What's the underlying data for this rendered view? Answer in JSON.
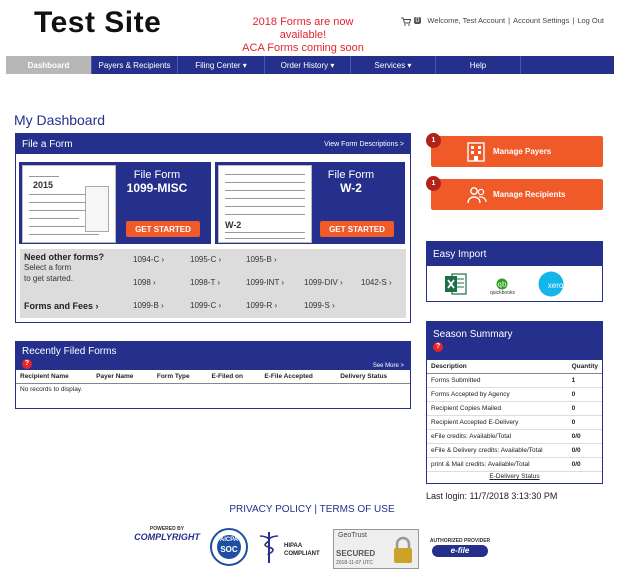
{
  "header": {
    "logo": "Test Site",
    "announce_line1": "2018 Forms are now available!",
    "announce_line2": "ACA Forms coming soon",
    "cart_count": "0",
    "welcome": "Welcome, Test Account",
    "account_settings": "Account Settings",
    "logout": "Log Out"
  },
  "nav": [
    {
      "label": "Dashboard",
      "active": true
    },
    {
      "label": "Payers & Recipients"
    },
    {
      "label": "Filing Center ▾"
    },
    {
      "label": "Order History ▾"
    },
    {
      "label": "Services ▾"
    },
    {
      "label": "Help"
    }
  ],
  "page_title": "My Dashboard",
  "file_form": {
    "title": "File a Form",
    "view_link": "View Form Descriptions >",
    "card1": {
      "label": "File Form",
      "form": "1099-MISC",
      "button": "GET STARTED"
    },
    "card2": {
      "label": "File Form",
      "form": "W-2",
      "button": "GET STARTED"
    },
    "need_other": "Need other forms?",
    "select_line1": "Select a form",
    "select_line2": "to get started.",
    "forms_row1": [
      "1094-C ›",
      "1095-C ›",
      "1095-B ›"
    ],
    "forms_row2": [
      "1098 ›",
      "1098-T ›",
      "1099-INT ›",
      "1099-DIV ›",
      "1042-S ›"
    ],
    "forms_fees": "Forms and Fees ›",
    "forms_row3": [
      "1099-B ›",
      "1099-C ›",
      "1099-R ›",
      "1099-S ›"
    ]
  },
  "recent": {
    "title": "Recently Filed Forms",
    "help": "?",
    "see_more": "See More >",
    "columns": [
      "Recipient Name",
      "Payer Name",
      "Form Type",
      "E-Filed on",
      "E-File Accepted",
      "Delivery Status"
    ],
    "empty": "No records to display."
  },
  "manage": {
    "payers_label": "Manage Payers",
    "payers_count": "1",
    "recipients_label": "Manage Recipients",
    "recipients_count": "1"
  },
  "easy_import": {
    "title": "Easy Import",
    "icons": [
      "excel-icon",
      "quickbooks-icon",
      "xero-icon"
    ],
    "qb_text": "quickbooks",
    "xero_text": "xero"
  },
  "season": {
    "title": "Season Summary",
    "help": "?",
    "col_desc": "Description",
    "col_qty": "Quantity",
    "rows": [
      {
        "d": "Forms Submitted",
        "q": "1"
      },
      {
        "d": "Forms Accepted by Agency",
        "q": "0"
      },
      {
        "d": "Recipient Copies Mailed",
        "q": "0"
      },
      {
        "d": "Recipient Accepted E-Delivery",
        "q": "0"
      },
      {
        "d": "eFile credits: Available/Total",
        "q": "0/0"
      },
      {
        "d": "eFile & Delivery credits: Available/Total",
        "q": "0/0"
      },
      {
        "d": "print & Mail credits: Available/Total",
        "q": "0/0"
      }
    ],
    "edelivery": "E-Delivery Status"
  },
  "last_login": "Last login: 11/7/2018 3:13:30 PM",
  "footer": {
    "privacy": "PRIVACY POLICY",
    "sep": " | ",
    "terms": "TERMS OF USE"
  },
  "badges": {
    "complyright_top": "POWERED BY",
    "complyright": "COMPLYRIGHT",
    "aicpa": "AICPA",
    "soc": "SOC",
    "hipaa": "HIPAA",
    "hipaa2": "COMPLIANT",
    "geotrust": "GeoTrust",
    "secured": "SECURED",
    "secured_date": "2018-11-07 UTC",
    "efile_top": "AUTHORIZED PROVIDER",
    "efile": "e-file"
  },
  "colors": {
    "navy": "#25308c",
    "orange": "#f05a28",
    "red": "#e3262d"
  }
}
